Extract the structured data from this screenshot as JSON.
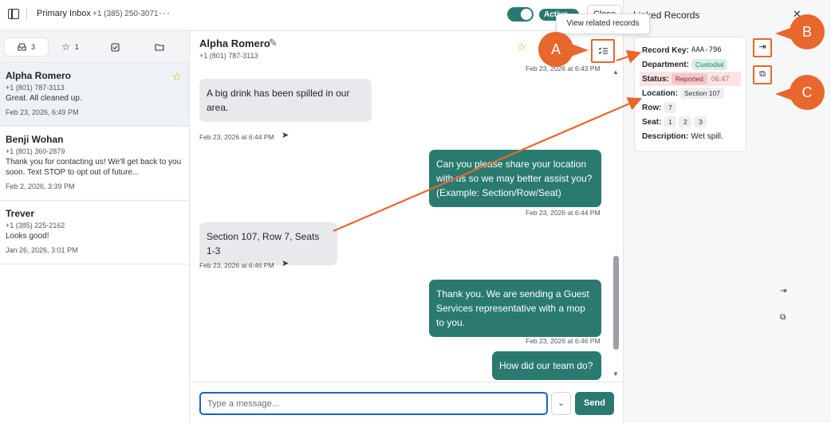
{
  "topbar": {
    "inbox_title": "Primary Inbox",
    "inbox_phone": "+1 (385) 250-3071",
    "more_label": "···",
    "active_label": "Active",
    "close_label": "Close"
  },
  "tabs": [
    {
      "icon": "inbox-icon",
      "count": "3"
    },
    {
      "icon": "star-icon",
      "count": "1"
    },
    {
      "icon": "checkbox-icon",
      "count": ""
    },
    {
      "icon": "folder-icon",
      "count": ""
    }
  ],
  "conversations": [
    {
      "name": "Alpha Romero",
      "phone": "+1 (801) 787-3113",
      "preview": "Great. All cleaned up.",
      "date": "Feb 23, 2026, 6:49 PM",
      "starred": true
    },
    {
      "name": "Benji Wohan",
      "phone": "+1 (801) 360-2879",
      "preview": "Thank you for contacting us! We'll get back to you soon. Text STOP to opt out of future...",
      "date": "Feb 2, 2026, 3:39 PM",
      "starred": false
    },
    {
      "name": "Trever",
      "phone": "+1 (385) 225-2162",
      "preview": "Looks good!",
      "date": "Jan 26, 2026, 3:01 PM",
      "starred": false
    }
  ],
  "chat": {
    "name": "Alpha Romero",
    "phone": "+1 (801) 787-3113",
    "tooltip": "View related records",
    "messages": [
      {
        "ts_top": "Feb 23, 2026 at 6:43 PM"
      },
      {
        "direction": "in",
        "text": "A big drink has been spilled in our area.",
        "ts": "Feb 23, 2026 at 6:44 PM"
      },
      {
        "direction": "out",
        "text": "Can you please share your location with us so we may better assist you? (Example: Section/Row/Seat)",
        "ts": "Feb 23, 2026 at 6:44 PM"
      },
      {
        "direction": "in",
        "text": "Section 107, Row 7, Seats 1-3",
        "ts": "Feb 23, 2026 at 6:46 PM"
      },
      {
        "direction": "out",
        "text": "Thank you. We are sending a Guest Services representative  with a mop to you.",
        "ts": "Feb 23, 2026 at 6:46 PM"
      },
      {
        "direction": "out",
        "text": "How did our team do?",
        "ts": ""
      }
    ],
    "input_placeholder": "Type a message...",
    "dropdown_label": "⌄",
    "send_label": "Send"
  },
  "records": {
    "title": "Linked Records",
    "record_key_label": "Record Key:",
    "record_key": "AAA-796",
    "department_label": "Department:",
    "department": "Custodial",
    "status_label": "Status:",
    "status": "Reported",
    "status_time": "06:47",
    "location_label": "Location:",
    "location": "Section 107",
    "row_label": "Row:",
    "row": "7",
    "seat_label": "Seat:",
    "seats": [
      "1",
      "2",
      "3"
    ],
    "description_label": "Description:",
    "description": "Wet spill."
  },
  "callouts": {
    "a": "A",
    "b": "B",
    "c": "C"
  },
  "colors": {
    "accent": "#2a7a6f",
    "annotation": "#e8672c",
    "star": "#d9a400"
  }
}
